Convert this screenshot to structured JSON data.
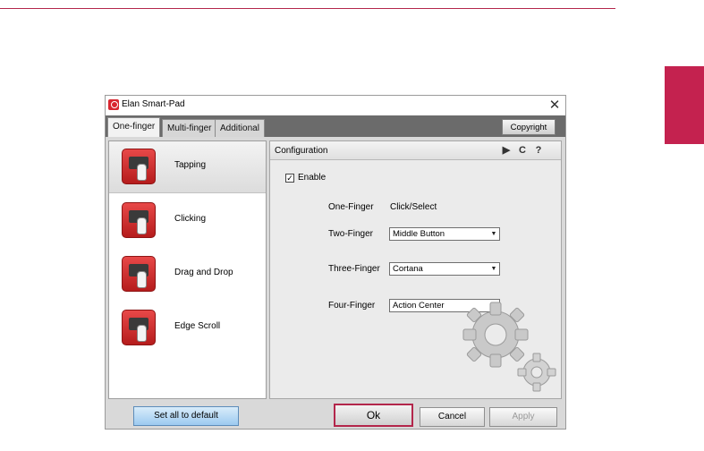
{
  "window": {
    "title": "Elan Smart-Pad",
    "close_glyph": "✕"
  },
  "tabs": [
    {
      "label": "One-finger",
      "active": true
    },
    {
      "label": "Multi-finger",
      "active": false
    },
    {
      "label": "Additional",
      "active": false
    }
  ],
  "copyright_label": "Copyright",
  "features": [
    {
      "label": "Tapping",
      "icon": "tapping-icon",
      "selected": true
    },
    {
      "label": "Clicking",
      "icon": "clicking-icon",
      "selected": false
    },
    {
      "label": "Drag and Drop",
      "icon": "drag-drop-icon",
      "selected": false
    },
    {
      "label": "Edge Scroll",
      "icon": "edge-scroll-icon",
      "selected": false
    }
  ],
  "config": {
    "title": "Configuration",
    "header_icons": {
      "play": "▶",
      "reset": "C",
      "help": "?"
    },
    "enable_label": "Enable",
    "enable_checked": true,
    "check_glyph": "✓",
    "one_finger": {
      "label": "One-Finger",
      "value": "Click/Select"
    },
    "two_finger": {
      "label": "Two-Finger",
      "value": "Middle Button"
    },
    "three_finger": {
      "label": "Three-Finger",
      "value": "Cortana"
    },
    "four_finger": {
      "label": "Four-Finger",
      "value": "Action Center"
    },
    "dropdown_glyph": "▼"
  },
  "buttons": {
    "set_all_default": "Set all to default",
    "ok": "Ok",
    "cancel": "Cancel",
    "apply": "Apply"
  },
  "colors": {
    "accent": "#c4224f",
    "icon_red": "#d8262f"
  }
}
